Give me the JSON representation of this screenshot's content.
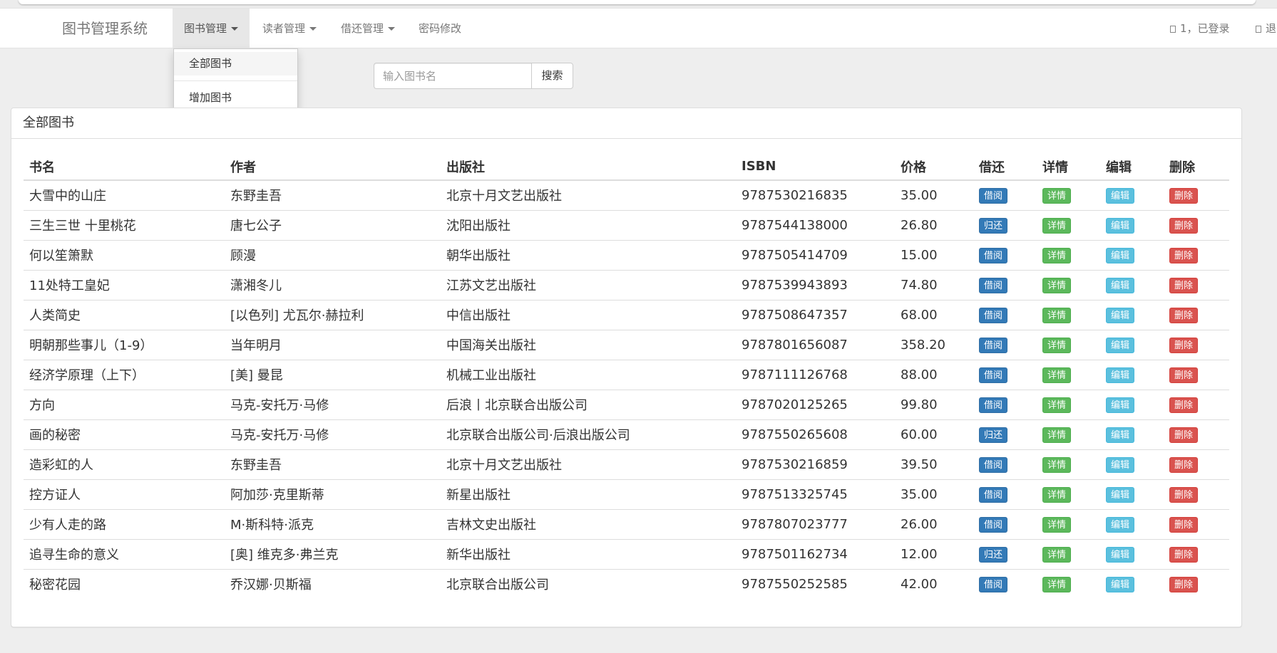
{
  "app": {
    "brand": "图书管理系统"
  },
  "nav": {
    "items": [
      {
        "label": "图书管理",
        "dropdown": true,
        "active": true
      },
      {
        "label": "读者管理",
        "dropdown": true,
        "active": false
      },
      {
        "label": "借还管理",
        "dropdown": true,
        "active": false
      },
      {
        "label": "密码修改",
        "dropdown": false,
        "active": false
      }
    ],
    "user_status": "1，已登录",
    "logout_label": "退"
  },
  "dropdown": {
    "items": [
      "全部图书",
      "增加图书"
    ]
  },
  "search": {
    "placeholder": "输入图书名",
    "value": "",
    "button_label": "搜索"
  },
  "panel": {
    "title": "全部图书"
  },
  "table": {
    "headers": [
      "书名",
      "作者",
      "出版社",
      "ISBN",
      "价格",
      "借还",
      "详情",
      "编辑",
      "删除"
    ],
    "detail_label": "详情",
    "edit_label": "编辑",
    "delete_label": "删除",
    "rows": [
      {
        "title": "大雪中的山庄",
        "author": "东野圭吾",
        "publisher": "北京十月文艺出版社",
        "isbn": "9787530216835",
        "price": "35.00",
        "action": "借阅"
      },
      {
        "title": "三生三世 十里桃花",
        "author": "唐七公子",
        "publisher": "沈阳出版社",
        "isbn": "9787544138000",
        "price": "26.80",
        "action": "归还"
      },
      {
        "title": "何以笙箫默",
        "author": "顾漫",
        "publisher": "朝华出版社",
        "isbn": "9787505414709",
        "price": "15.00",
        "action": "借阅"
      },
      {
        "title": "11处特工皇妃",
        "author": "潇湘冬儿",
        "publisher": "江苏文艺出版社",
        "isbn": "9787539943893",
        "price": "74.80",
        "action": "借阅"
      },
      {
        "title": "人类简史",
        "author": "[以色列] 尤瓦尔·赫拉利",
        "publisher": "中信出版社",
        "isbn": "9787508647357",
        "price": "68.00",
        "action": "借阅"
      },
      {
        "title": "明朝那些事儿（1-9）",
        "author": "当年明月",
        "publisher": "中国海关出版社",
        "isbn": "9787801656087",
        "price": "358.20",
        "action": "借阅"
      },
      {
        "title": "经济学原理（上下）",
        "author": "[美] 曼昆",
        "publisher": "机械工业出版社",
        "isbn": "9787111126768",
        "price": "88.00",
        "action": "借阅"
      },
      {
        "title": "方向",
        "author": "马克-安托万·马修",
        "publisher": "后浪丨北京联合出版公司",
        "isbn": "9787020125265",
        "price": "99.80",
        "action": "借阅"
      },
      {
        "title": "画的秘密",
        "author": "马克-安托万·马修",
        "publisher": "北京联合出版公司·后浪出版公司",
        "isbn": "9787550265608",
        "price": "60.00",
        "action": "归还"
      },
      {
        "title": "造彩虹的人",
        "author": "东野圭吾",
        "publisher": "北京十月文艺出版社",
        "isbn": "9787530216859",
        "price": "39.50",
        "action": "借阅"
      },
      {
        "title": "控方证人",
        "author": "阿加莎·克里斯蒂",
        "publisher": "新星出版社",
        "isbn": "9787513325745",
        "price": "35.00",
        "action": "借阅"
      },
      {
        "title": "少有人走的路",
        "author": "M·斯科特·派克",
        "publisher": "吉林文史出版社",
        "isbn": "9787807023777",
        "price": "26.00",
        "action": "借阅"
      },
      {
        "title": "追寻生命的意义",
        "author": "[奥] 维克多·弗兰克",
        "publisher": "新华出版社",
        "isbn": "9787501162734",
        "price": "12.00",
        "action": "归还"
      },
      {
        "title": "秘密花园",
        "author": "乔汉娜·贝斯福",
        "publisher": "北京联合出版公司",
        "isbn": "9787550252585",
        "price": "42.00",
        "action": "借阅"
      }
    ]
  }
}
